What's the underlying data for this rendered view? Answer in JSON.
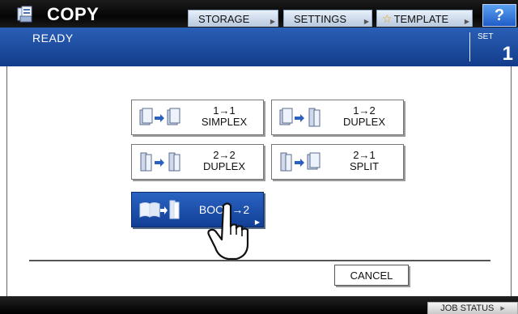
{
  "header": {
    "title": "COPY",
    "buttons": [
      {
        "label": "STORAGE"
      },
      {
        "label": "SETTINGS"
      },
      {
        "label": "TEMPLATE"
      }
    ],
    "help_label": "?"
  },
  "status": {
    "text": "READY",
    "set_label": "SET",
    "set_value": "1"
  },
  "options": [
    {
      "line1": "1→1",
      "line2": "SIMPLEX",
      "icon": "simplex-to-simplex-icon",
      "selected": false
    },
    {
      "line1": "1→2",
      "line2": "DUPLEX",
      "icon": "simplex-to-duplex-icon",
      "selected": false
    },
    {
      "line1": "2→2",
      "line2": "DUPLEX",
      "icon": "duplex-to-duplex-icon",
      "selected": false
    },
    {
      "line1": "2→1",
      "line2": "SPLIT",
      "icon": "duplex-to-split-icon",
      "selected": false
    },
    {
      "line1": "BOOK→2",
      "line2": "",
      "icon": "book-to-duplex-icon",
      "selected": true
    }
  ],
  "cancel_label": "CANCEL",
  "footer": {
    "job_status_label": "JOB STATUS"
  },
  "colors": {
    "accent": "#1a4ca8",
    "header_bg": "#0a0a0a",
    "selected_btn": "#1e56b4"
  }
}
